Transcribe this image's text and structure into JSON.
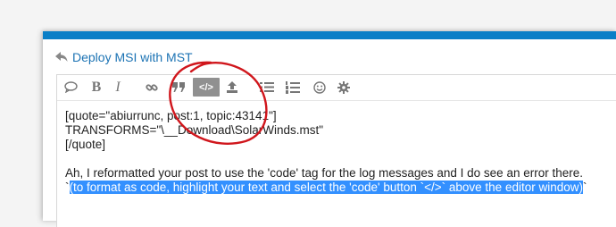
{
  "reply": {
    "icon": "reply-arrow-icon",
    "topic_title": "Deploy MSI with MST"
  },
  "toolbar": {
    "buttons": [
      {
        "name": "emoji-bubble-icon",
        "label": ""
      },
      {
        "name": "bold-button",
        "label": "B"
      },
      {
        "name": "italic-button",
        "label": "I"
      },
      {
        "name": "link-icon",
        "label": ""
      },
      {
        "name": "quote-icon",
        "label": ""
      },
      {
        "name": "code-icon",
        "label": "</>"
      },
      {
        "name": "upload-icon",
        "label": ""
      },
      {
        "name": "bullet-list-icon",
        "label": ""
      },
      {
        "name": "numbered-list-icon",
        "label": ""
      },
      {
        "name": "emoji-icon",
        "label": ""
      },
      {
        "name": "gear-icon",
        "label": ""
      }
    ],
    "active_button": "code-icon"
  },
  "editor": {
    "lines": [
      "[quote=\"abiurrunc, post:1, topic:43141\"]",
      "TRANSFORMS=\"\\__Download\\SolarWinds.mst\"",
      "[/quote]",
      "",
      "Ah, I reformatted your post to use the 'code' tag for the log messages and I do see an error there.",
      "`"
    ],
    "selected_text": "(to format as code, highlight your text and select the 'code' button `</>` above the editor window)",
    "trailing_text": "`"
  },
  "colors": {
    "topbar": "#0a7fc7",
    "link": "#1c73b4",
    "selection": "#3390ff",
    "annotation_circle": "#d0161c"
  }
}
